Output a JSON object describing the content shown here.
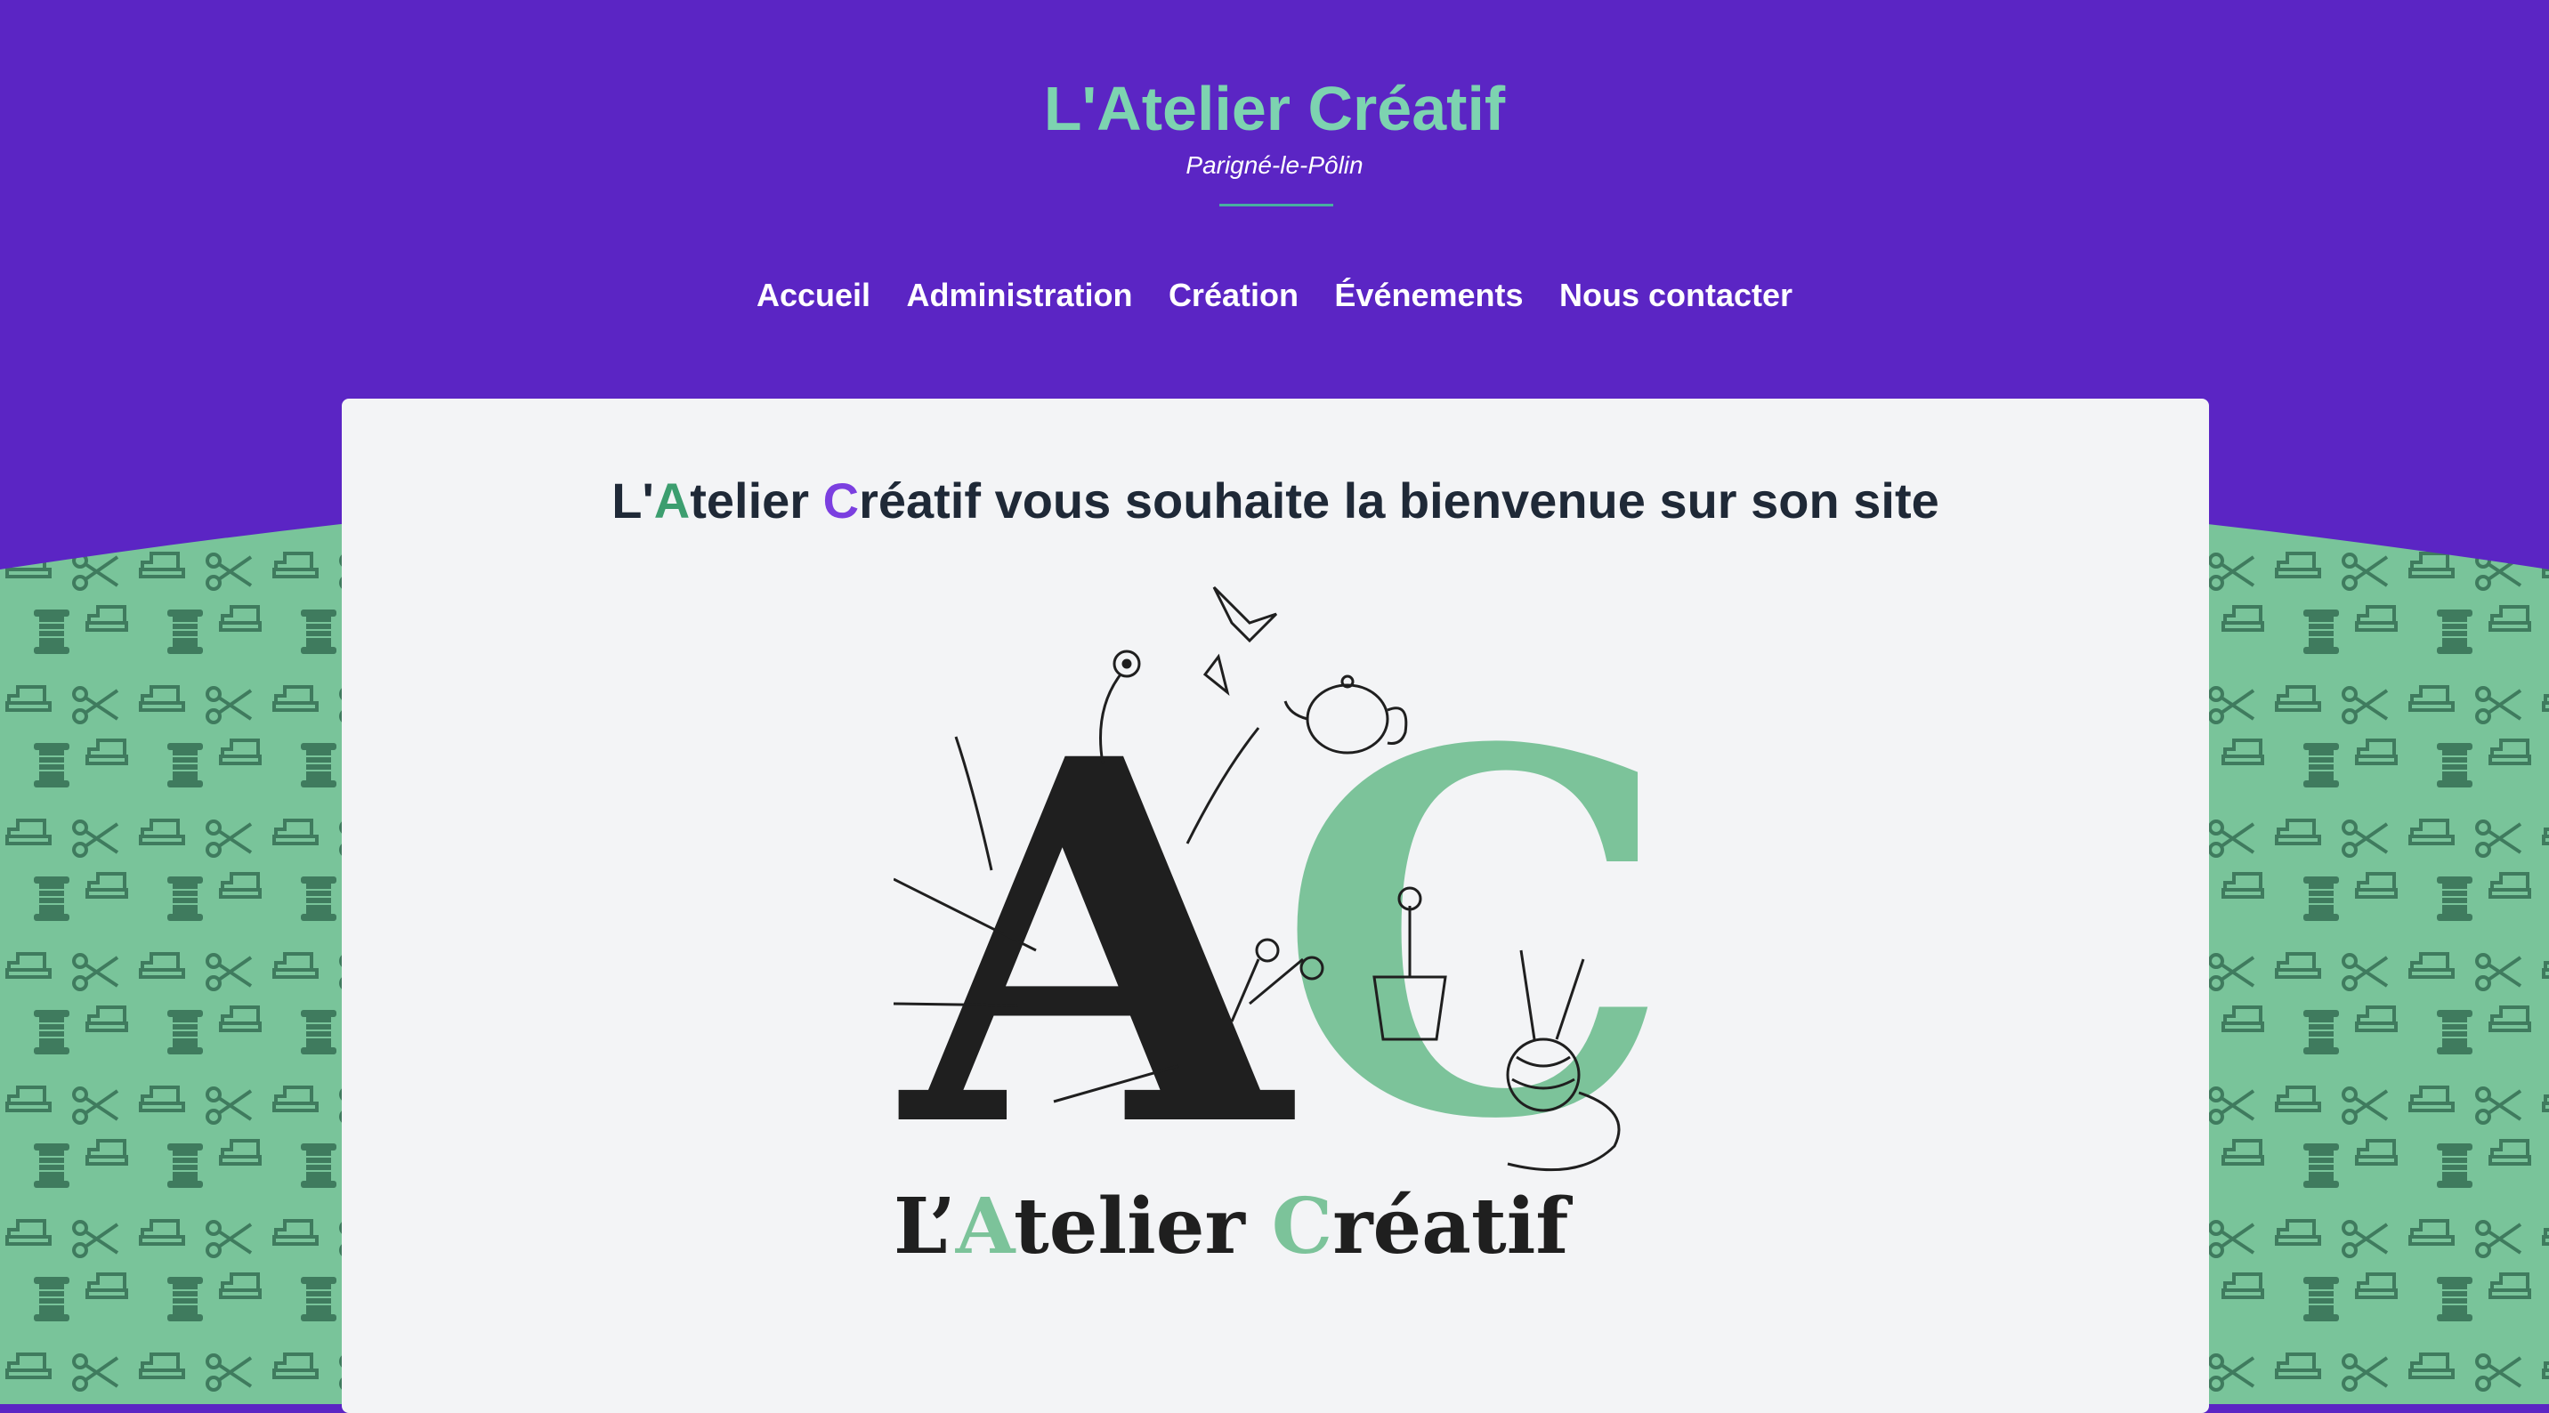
{
  "site": {
    "title": "L'Atelier Créatif",
    "subtitle": "Parigné-le-Pôlin"
  },
  "nav": {
    "items": [
      {
        "label": "Accueil"
      },
      {
        "label": "Administration"
      },
      {
        "label": "Création"
      },
      {
        "label": "Événements"
      },
      {
        "label": "Nous contacter"
      }
    ]
  },
  "main": {
    "welcome": {
      "prefix": "L'",
      "a": "A",
      "mid": "telier ",
      "c": "C",
      "suffix": "réatif vous souhaite la bienvenue sur son site"
    },
    "logo": {
      "big_a": "A",
      "big_c": "C",
      "wordmark_prefix": "L’",
      "wordmark_a": "A",
      "wordmark_mid": "telier ",
      "wordmark_c": "C",
      "wordmark_suffix": "réatif"
    }
  },
  "colors": {
    "header_bg": "#5b25c4",
    "title_color": "#7dd3b0",
    "pattern_bg": "#79c49a",
    "logo_green": "#7cc39a",
    "logo_black": "#1f1f1f",
    "card_bg": "#f3f4f6"
  },
  "icons": [
    "sewing-machine-icon",
    "scissors-icon",
    "thread-spool-icon"
  ]
}
